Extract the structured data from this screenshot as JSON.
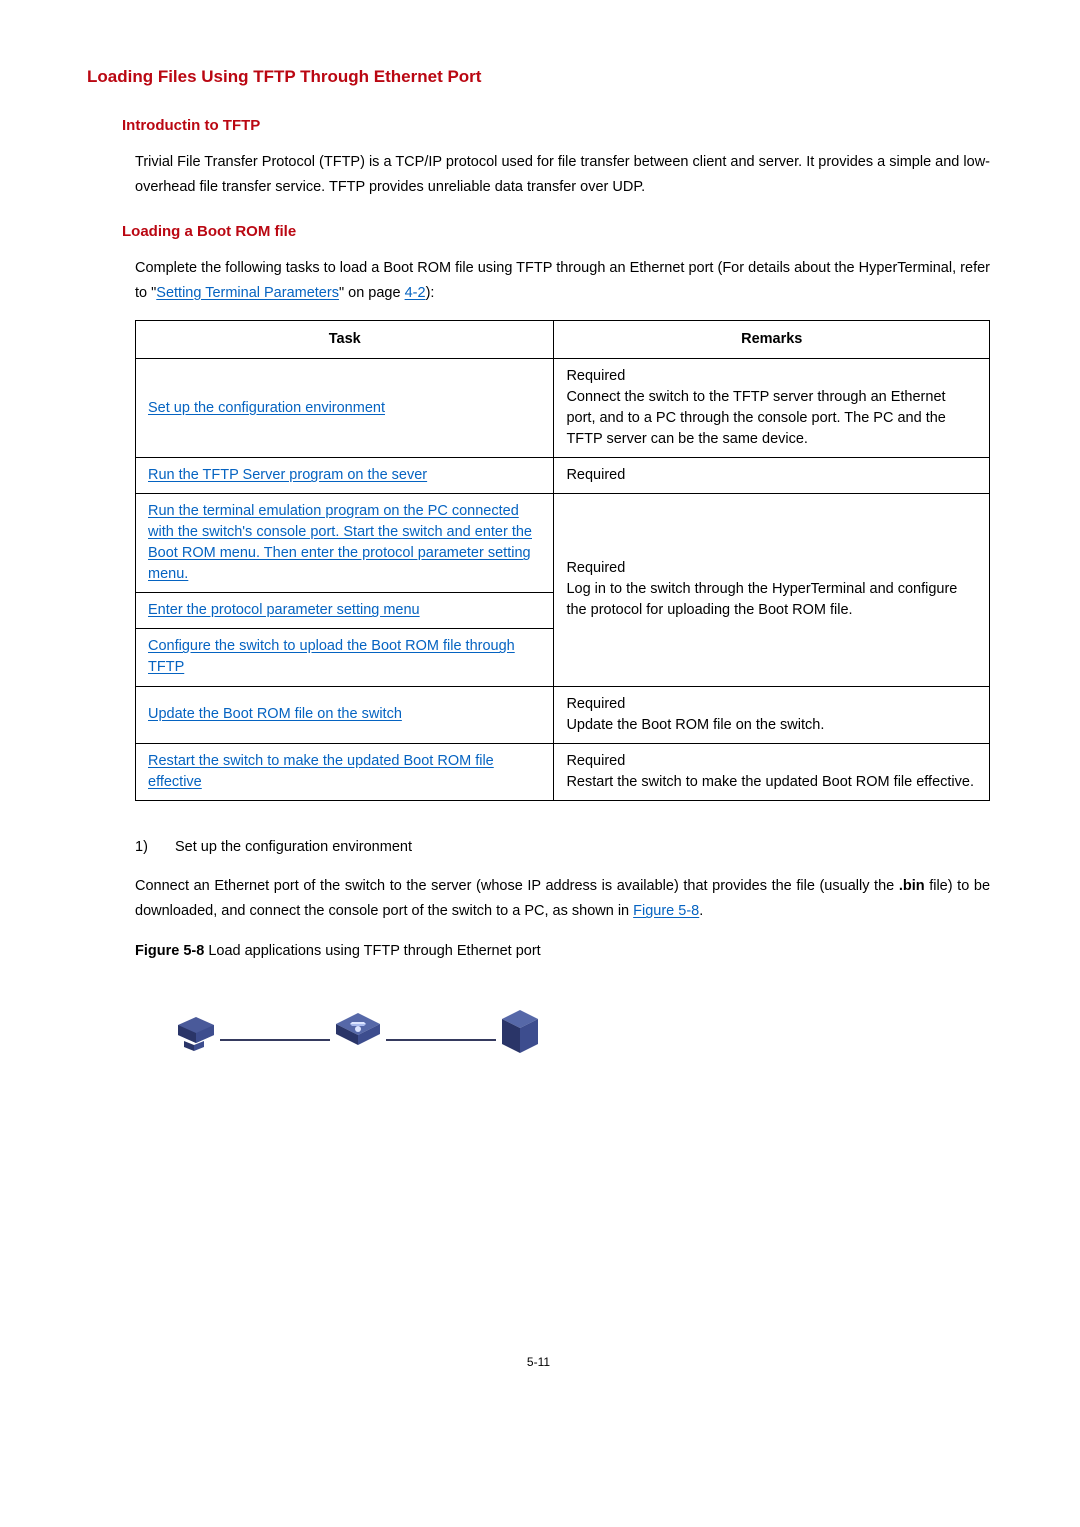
{
  "h1": "Loading Files Using TFTP Through Ethernet Port",
  "h2a": "Introductin to TFTP",
  "p1": "Trivial File Transfer Protocol (TFTP) is a TCP/IP protocol used for file transfer between client and server. It provides a simple and low-overhead file transfer service. TFTP provides unreliable data transfer over UDP.",
  "h2b": "Loading a Boot ROM file",
  "p2_pre": "Complete the following tasks to load a Boot ROM file using TFTP through an Ethernet port (For details about the HyperTerminal, refer to \"",
  "p2_link": "Setting Terminal Parameters",
  "p2_mid": "\" on page ",
  "p2_link2": "4-2",
  "p2_post": "):",
  "th_task": "Task",
  "th_remarks": "Remarks",
  "rows": [
    {
      "task_link": "Set up the configuration environment",
      "remarks": "Required\nConnect the switch to the TFTP server through an Ethernet port, and to a PC through the console port. The PC and the TFTP server can be the same device."
    },
    {
      "task_link": "Run the TFTP Server program on the sever",
      "remarks": "Required"
    },
    {
      "task_link": "Run the terminal emulation program on the PC connected with the switch's console port. Start the switch and enter the Boot ROM menu. Then enter the protocol parameter setting menu.",
      "sub1": "Enter the protocol parameter setting menu",
      "sub2": "Configure the switch to upload the Boot ROM file through TFTP",
      "remarks": "Required\nLog in to the switch through the HyperTerminal and configure the protocol for uploading the Boot ROM file."
    },
    {
      "task_link": "Update the Boot ROM file on the switch",
      "remarks": "Required\nUpdate the Boot ROM file on the switch."
    },
    {
      "task_link": "Restart the switch to make the updated Boot ROM file effective",
      "remarks": "Required\nRestart the switch to make the updated Boot ROM file effective."
    }
  ],
  "step_num": "1)",
  "step_text": "Set up the configuration environment",
  "p3_pre": "Connect an Ethernet port of the switch to the server (whose IP address is available) that provides the file (usually the ",
  "p3_bold": ".bin",
  "p3_mid": " file) to be downloaded, and connect the console port of the switch to a PC, as shown in ",
  "p3_link": "Figure 5-8",
  "p3_post": ".",
  "fig_bold": "Figure 5-8 ",
  "fig_text": "Load applications using TFTP through Ethernet port",
  "page_num": "5-11"
}
